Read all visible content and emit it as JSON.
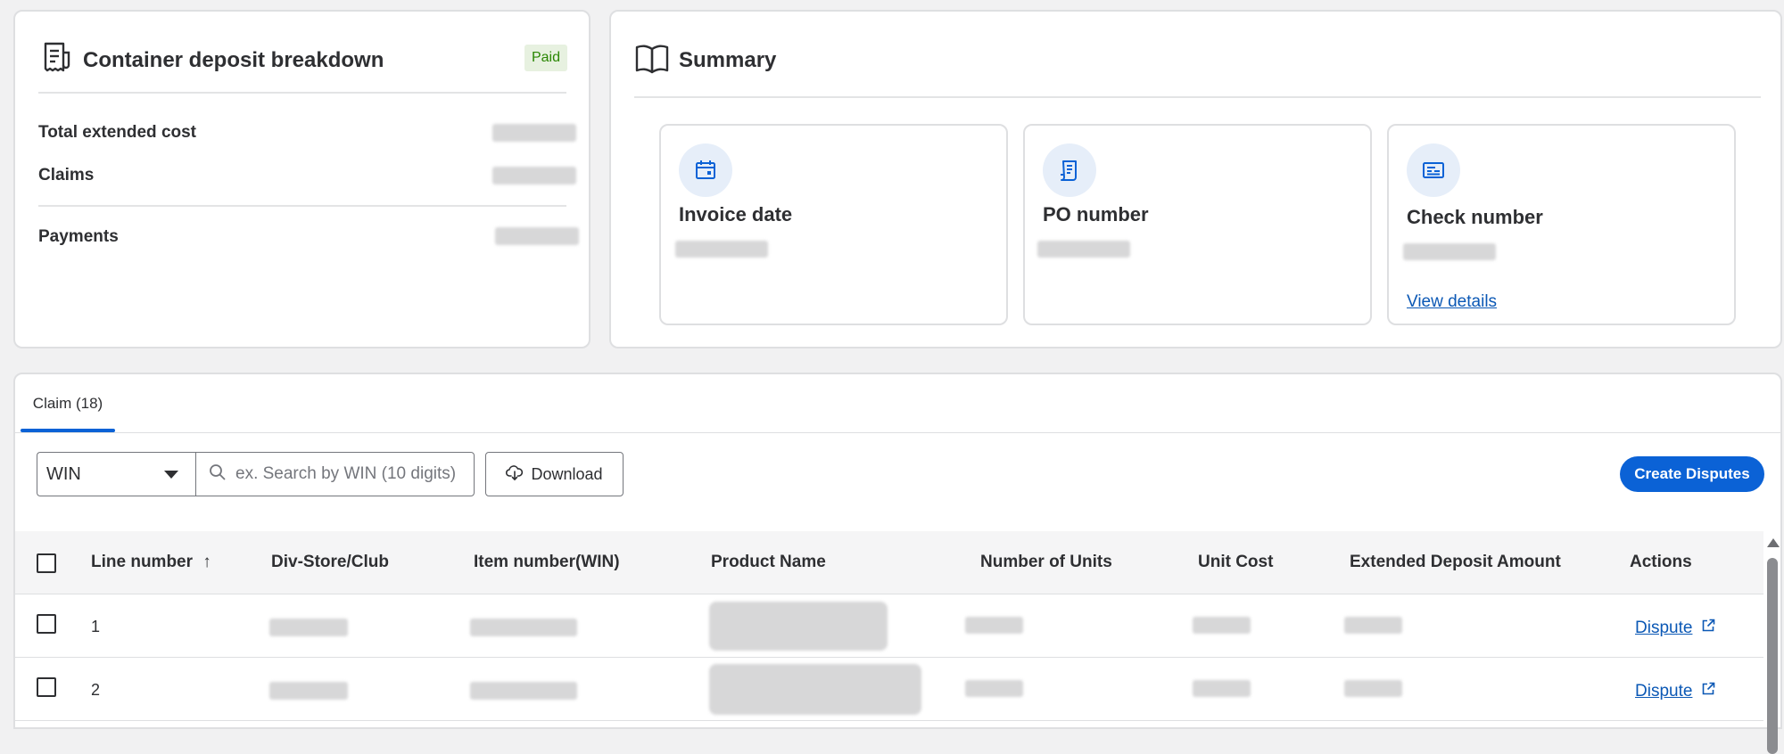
{
  "breakdown": {
    "title": "Container deposit breakdown",
    "status_badge": "Paid",
    "rows": [
      {
        "label": "Total extended cost"
      },
      {
        "label": "Claims"
      },
      {
        "label": "Payments"
      }
    ]
  },
  "summary": {
    "title": "Summary",
    "tiles": [
      {
        "label": "Invoice date",
        "icon": "calendar-icon"
      },
      {
        "label": "PO number",
        "icon": "document-icon"
      },
      {
        "label": "Check number",
        "icon": "check-icon",
        "link": "View details"
      }
    ]
  },
  "claims": {
    "tab_label": "Claim (18)",
    "filter_select_value": "WIN",
    "search_placeholder": "ex. Search by WIN (10 digits)",
    "download_label": "Download",
    "create_disputes_label": "Create Disputes",
    "columns": [
      "Line number",
      "Div-Store/Club",
      "Item number(WIN)",
      "Product Name",
      "Number of Units",
      "Unit Cost",
      "Extended Deposit Amount",
      "Actions"
    ],
    "sort_indicator": "↑",
    "rows": [
      {
        "line": "1",
        "action": "Dispute"
      },
      {
        "line": "2",
        "action": "Dispute"
      }
    ]
  },
  "colors": {
    "accent": "#0b62d6",
    "link": "#0b58b5",
    "paid_bg": "#e7f1e0",
    "paid_text": "#2a8703"
  }
}
